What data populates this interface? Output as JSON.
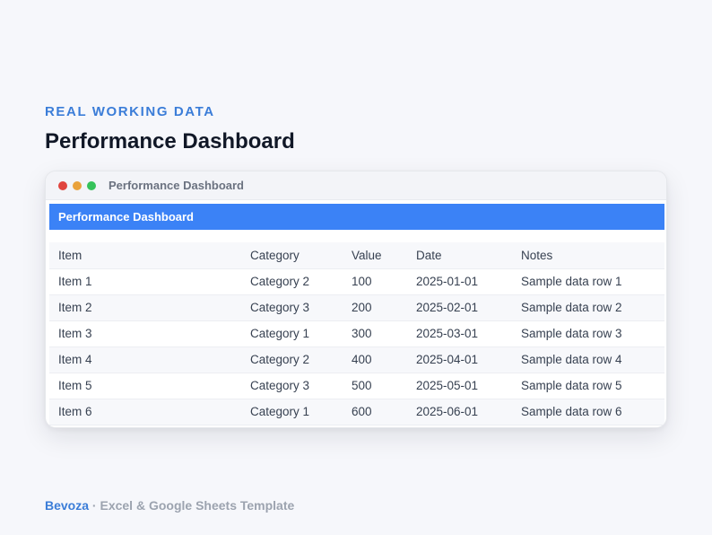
{
  "eyebrow": "REAL WORKING DATA",
  "page_title": "Performance Dashboard",
  "window": {
    "title": "Performance Dashboard",
    "sheet_header": "Performance Dashboard",
    "traffic_lights": [
      "close",
      "minimize",
      "maximize"
    ]
  },
  "table": {
    "columns": [
      "Item",
      "Category",
      "Value",
      "Date",
      "Notes"
    ],
    "rows": [
      [
        "Item 1",
        "Category 2",
        "100",
        "2025-01-01",
        "Sample data row 1"
      ],
      [
        "Item 2",
        "Category 3",
        "200",
        "2025-02-01",
        "Sample data row 2"
      ],
      [
        "Item 3",
        "Category 1",
        "300",
        "2025-03-01",
        "Sample data row 3"
      ],
      [
        "Item 4",
        "Category 2",
        "400",
        "2025-04-01",
        "Sample data row 4"
      ],
      [
        "Item 5",
        "Category 3",
        "500",
        "2025-05-01",
        "Sample data row 5"
      ],
      [
        "Item 6",
        "Category 1",
        "600",
        "2025-06-01",
        "Sample data row 6"
      ]
    ]
  },
  "footer": {
    "brand": "Bevoza",
    "separator": " · ",
    "text": "Excel & Google Sheets Template"
  },
  "colors": {
    "accent": "#3b7dd8",
    "header_bar": "#3b82f6",
    "close": "#e0443e",
    "minimize": "#e9a23b",
    "maximize": "#35c25a"
  }
}
